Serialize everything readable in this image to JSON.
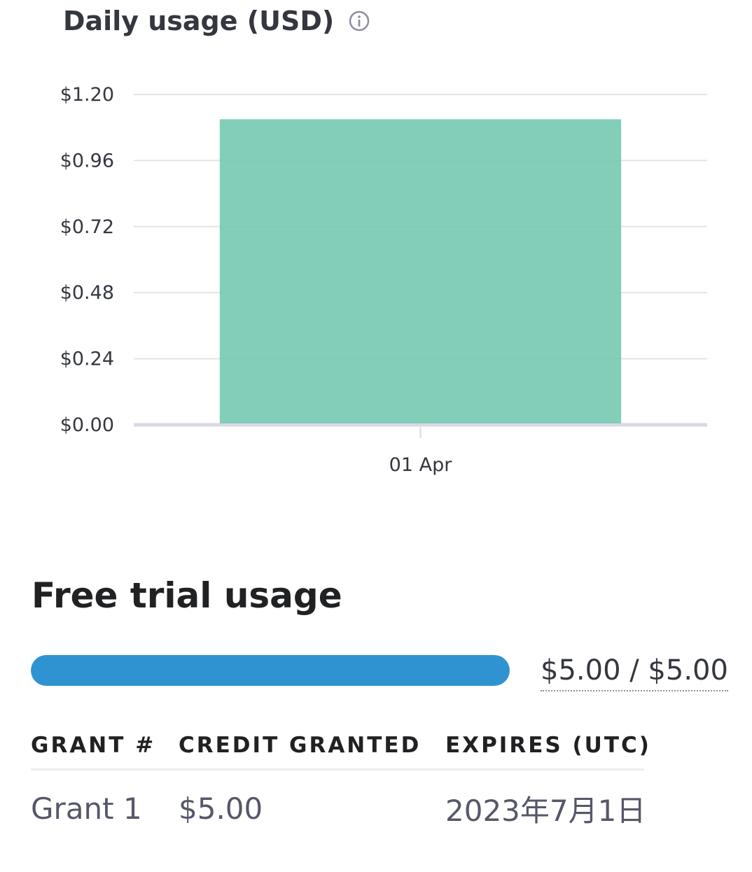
{
  "usage": {
    "title": "Daily usage (USD)",
    "info_icon": "info-icon"
  },
  "chart_data": {
    "type": "bar",
    "title": "Daily usage (USD)",
    "categories": [
      "01 Apr"
    ],
    "values": [
      1.11
    ],
    "ylim": [
      0,
      1.2
    ],
    "yticks": [
      "$1.20",
      "$0.96",
      "$0.72",
      "$0.48",
      "$0.24",
      "$0.00"
    ],
    "ytick_values": [
      1.2,
      0.96,
      0.72,
      0.48,
      0.24,
      0
    ],
    "grid": true,
    "colors": {
      "bar": "#74c9b0"
    }
  },
  "free_trial": {
    "title": "Free trial usage",
    "progress_fraction": 1.0,
    "amount_label": "$5.00 / $5.00",
    "colors": {
      "fill": "#2f93d1"
    }
  },
  "grants": {
    "columns": [
      "GRANT #",
      "CREDIT GRANTED",
      "EXPIRES (UTC)"
    ],
    "rows": [
      {
        "grant": "Grant 1",
        "credit": "$5.00",
        "expires": "2023年7月1日"
      }
    ]
  }
}
